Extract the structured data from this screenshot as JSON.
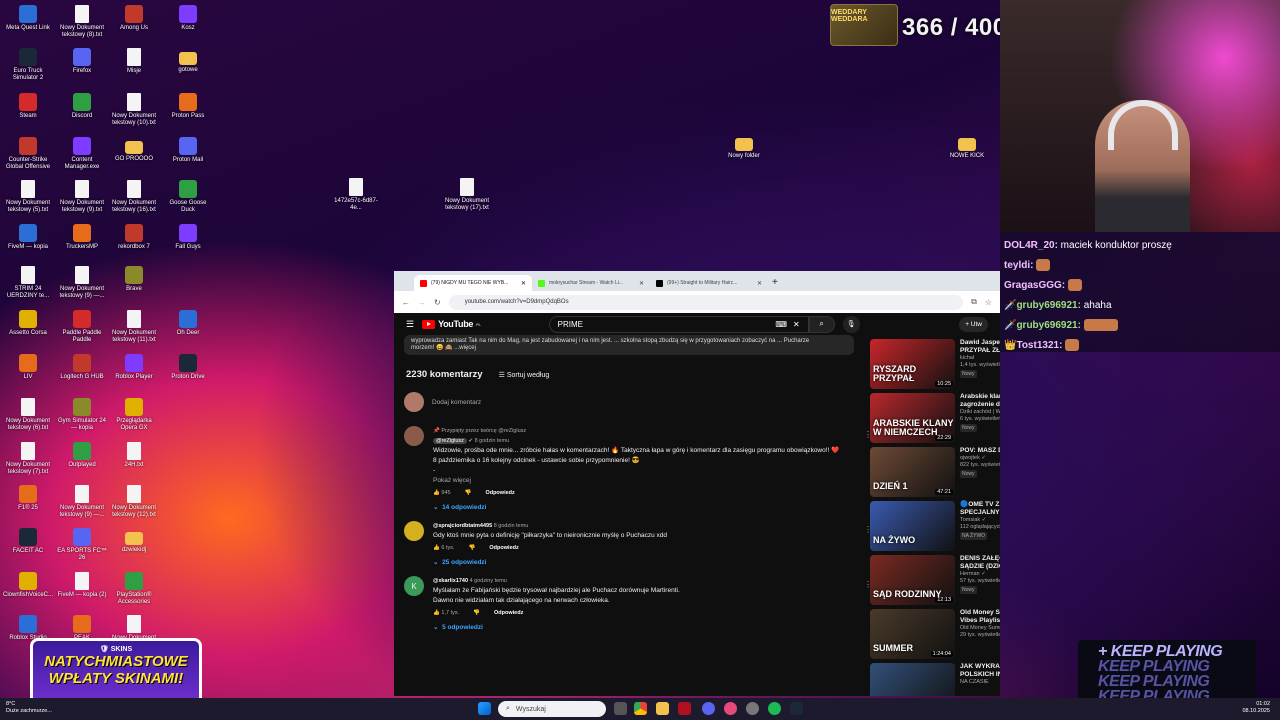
{
  "desktop_icons": [
    {
      "label": "Meta Quest Link",
      "x": 0
    },
    {
      "label": "Nowy Dokument tekstowy (8).txt"
    },
    {
      "label": "Among Us"
    },
    {
      "label": "Kosz"
    },
    {
      "label": "Euro Truck Simulator 2"
    },
    {
      "label": "Firefox"
    },
    {
      "label": "Misje"
    },
    {
      "label": "gotowe"
    },
    {
      "label": "Steam"
    },
    {
      "label": "Discord"
    },
    {
      "label": "Nowy Dokument tekstowy (10).txt"
    },
    {
      "label": "Proton Pass"
    },
    {
      "label": "Counter-Strike Global Offensive"
    },
    {
      "label": "Content Manager.exe"
    },
    {
      "label": "GO PROOOO"
    },
    {
      "label": "Proton Mail"
    },
    {
      "label": "Nowy Dokument tekstowy (5).txt"
    },
    {
      "label": "Nowy Dokument tekstowy (9).txt"
    },
    {
      "label": "Nowy Dokument tekstowy (16).txt"
    },
    {
      "label": "Goose Goose Duck"
    },
    {
      "label": "FiveM — kopia"
    },
    {
      "label": "TruckersMP"
    },
    {
      "label": "rekordbox 7"
    },
    {
      "label": "Fall Guys"
    },
    {
      "label": "STRIM 24 UERDZINY te..."
    },
    {
      "label": "Nowy Dokument tekstowy (9) —..."
    },
    {
      "label": "Brave"
    },
    {
      "label": "Assetto Corsa"
    },
    {
      "label": "Paddle Paddle Paddle"
    },
    {
      "label": "Nowy Dokument tekstowy (11).txt"
    },
    {
      "label": "Oh Deer"
    },
    {
      "label": "LIV"
    },
    {
      "label": "Logitech G HUB"
    },
    {
      "label": "Roblox Player"
    },
    {
      "label": "Proton Drive"
    },
    {
      "label": "Nowy Dokument tekstowy (6).txt"
    },
    {
      "label": "Gym Simulator 24 — kopia"
    },
    {
      "label": "Przeglądarka Opera GX"
    },
    {
      "label": "Nowy Dokument tekstowy (7).txt"
    },
    {
      "label": "Outplayed"
    },
    {
      "label": "24H.txt"
    },
    {
      "label": "F1® 25"
    },
    {
      "label": "Nowy Dokument tekstowy (9) —..."
    },
    {
      "label": "Nowy Dokument tekstowy (12).txt"
    },
    {
      "label": "FACEIT AC"
    },
    {
      "label": "EA SPORTS FC™ 26"
    },
    {
      "label": "dzwiekidj"
    },
    {
      "label": "ClownfishVoiceC..."
    },
    {
      "label": "FiveM — kopia (2)"
    },
    {
      "label": "PlayStation® Accessories"
    },
    {
      "label": "Roblox Studio"
    },
    {
      "label": "PEAK"
    },
    {
      "label": "Nowy Dokument"
    },
    {
      "label": "Chatter..."
    },
    {
      "label": "1472e57c-6d87-4e..."
    },
    {
      "label": "Nowy Dokument tekstowy (17).txt"
    },
    {
      "label": "Nowy folder"
    },
    {
      "label": "NOWE KICK"
    }
  ],
  "browser": {
    "tabs": [
      {
        "title": "(79) NIGDY MU TEGO NIE WYB..."
      },
      {
        "title": "mokrysuchar Stream - Watch Li..."
      },
      {
        "title": "(99+) Straight to Military Hairc..."
      }
    ],
    "url": "youtube.com/watch?v=D9dmpQdqBOs"
  },
  "youtube": {
    "logo": "YouTube",
    "logo_sup": "PL",
    "search_value": "PRIME",
    "create_label": "Utw",
    "desc_text1": "wyprowadza zamiast Tak na nim do Mag, na jest zabudowanej i na nim jest. ... szkolna stopą zbudzą się w przygotowaniach zobaczyć na ... Pucharze",
    "desc_text2": "morzem! 😄 🙈 ...więcej",
    "comments_count": "2230 komentarzy",
    "sort_label": "Sortuj według",
    "add_comment": "Dodaj komentarz",
    "comments": [
      {
        "pinned": "Przypięty przez twórcę @reZiglusz",
        "author": "@reZiglusz",
        "time": "8 godzin temu",
        "lines": [
          "Widzowie, prośba ode mnie... zróbcie hałas w komentarzach! 🔥 Taktyczna łapa w górę i komentarz dla zasięgu programu obowiązkowo!! ❤️",
          "8 października o 16 kolejny odcinek - ustawcie sobie przypomnienie! 😎",
          "-"
        ],
        "show_more": "Pokaż więcej",
        "likes": "945",
        "reply": "Odpowiedz",
        "replies": "14 odpowiedzi"
      },
      {
        "author": "@sprajciordbtatm4495",
        "time": "8 godzin temu",
        "lines": [
          "Gdy ktoś mnie pyta o definicję \"piłkarzyka\" to nieironicznie myślę o Puchaczu xdd"
        ],
        "likes": "6 tys.",
        "reply": "Odpowiedz",
        "replies": "25 odpowiedzi"
      },
      {
        "author": "@xkarlix1740",
        "time": "4 godziny temu",
        "lines": [
          "Myślałam że Fabijański będzie trysował najbardziej ale Puchacz dorównuje Martirenti.",
          "Dawno nie widziałam tak działającego na nerwach człowieka."
        ],
        "likes": "1,7 tys.",
        "reply": "Odpowiedz",
        "replies": "5 odpowiedzi"
      }
    ],
    "sidebar": [
      {
        "title": "Dawid Jasper RYSZARD PRZYPAŁ ZŁODZIEJA",
        "channel": "kichał",
        "meta": "1,4 tys. wyświetleń • 9 godzin temu",
        "badge": "Nowy",
        "dur": "10:25",
        "thumb_text": "RYSZARD PRZYPAŁ",
        "color": "#c8262a"
      },
      {
        "title": "Arabskie klany – największe zagrożenie dla Niemiec?",
        "channel": "Dziki zachód | Wilczyński",
        "meta": "6 tys. wyświetleń • 9 godzin temu",
        "badge": "Nowy",
        "dur": "22:29",
        "thumb_text": "ARABSKIE KLANY W NIEMCZECH",
        "color": "#b8282c"
      },
      {
        "title": "POV: MASZ DOZÓR POLICYJNY",
        "channel": "ojwojtek ✓",
        "meta": "822 tys. wyświetleń • 1 dzień temu",
        "badge": "Nowy",
        "dur": "47:21",
        "thumb_text": "DZIEŃ 1",
        "color": "#6e4a36"
      },
      {
        "title": "🔵OME TV Z GOŚCMI SPECJALNYMI NA ...",
        "channel": "Tomsiak ✓",
        "meta": "112 oglądających",
        "badge": "NA ŻYWO",
        "dur": "",
        "thumb_text": "NA ŻYWO",
        "color": "#3a5ab0"
      },
      {
        "title": "DENIS ZAŁĘCKI - ROZPRAWA W SĄDZIE (DZIGI, SZACHTA)",
        "channel": "Herman ✓",
        "meta": "57 tys. wyświetleń • 9 godzin temu",
        "badge": "Nowy",
        "dur": "12:13",
        "thumb_text": "SĄD RODZINNY",
        "color": "#7a2a22"
      },
      {
        "title": "Old Money Summer - Old Money Vibes Playlist",
        "channel": "Old Money Summer",
        "meta": "29 tys. wyświetleń • 1 miesiąc temu",
        "badge": "",
        "dur": "1:24:04",
        "thumb_text": "SUMMER",
        "color": "#4a3a2a"
      },
      {
        "title": "JAK WYKRADŁEM DANE POLSKICH INFLUENCERÓW",
        "channel": "NA CZASIE",
        "meta": "",
        "badge": "",
        "dur": "",
        "thumb_text": "",
        "color": "#33507a"
      }
    ]
  },
  "overlay": {
    "counter": "366 / 400",
    "wed_badge": "WEDDARY WEDDARA",
    "chat": [
      {
        "name": "DOL4R_20:",
        "msg": " maciek konduktor proszę"
      },
      {
        "name": "teyldi:",
        "msg": ""
      },
      {
        "name": "GragasGGG:",
        "msg": ""
      },
      {
        "name": "gruby696921:",
        "msg": " ahaha"
      },
      {
        "name": "gruby696921:",
        "msg": ""
      },
      {
        "name": "Tost1321:",
        "msg": ""
      }
    ],
    "keep_playing": "KEEP PLAYING",
    "ad_logo": "SKINS",
    "ad_line1": "NATYCHMIASTOWE",
    "ad_line2": "WPŁATY SKINAMI!"
  },
  "taskbar": {
    "search_placeholder": "Wyszukaj",
    "weather_temp": "8°C",
    "weather_desc": "Duże zachmurze...",
    "time": "01:02",
    "date": "08.10.2025"
  },
  "colors": {
    "yt_bg": "#0f0f0f",
    "yt_red": "#ff0000",
    "link_blue": "#3ea6ff"
  }
}
